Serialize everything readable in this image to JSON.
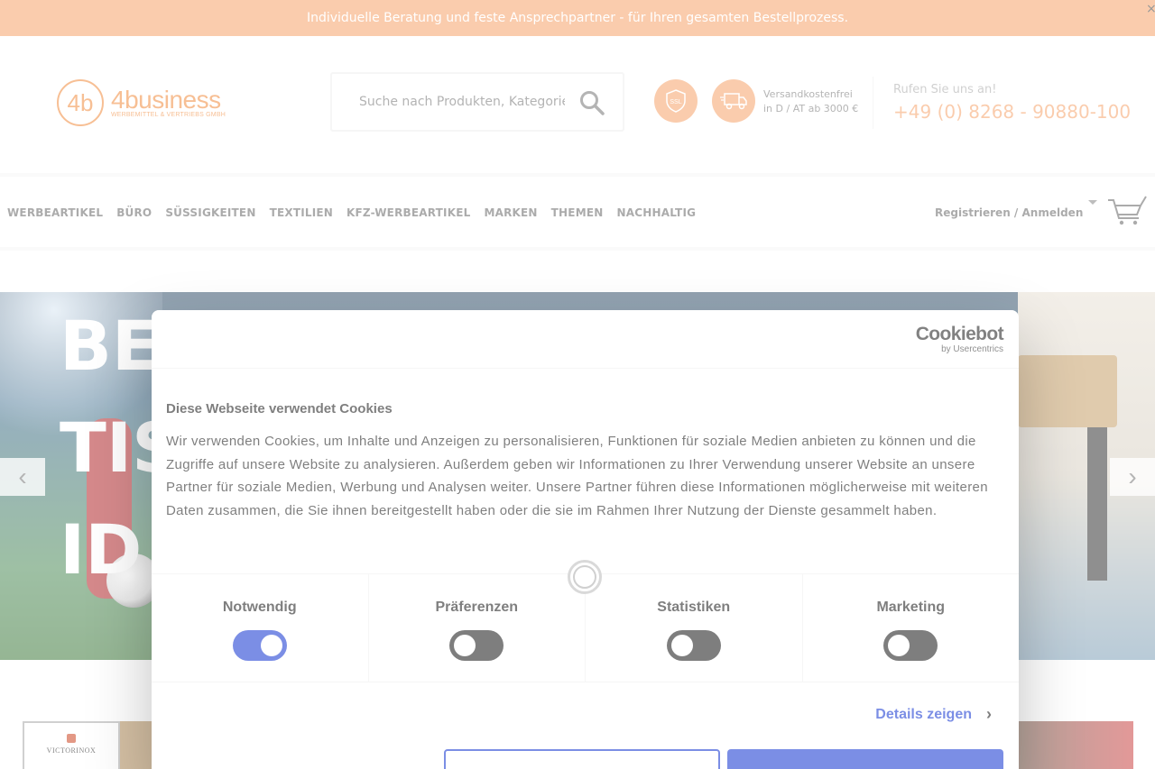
{
  "topbar": {
    "message": "Individuelle Beratung und feste Ansprechpartner - für Ihren gesamten Bestellprozess.",
    "close": "×"
  },
  "header": {
    "logo_mark": "4b",
    "logo_name": "4business",
    "logo_sub": "WERBEMITTEL & VERTRIEBS GMBH",
    "search_placeholder": "Suche nach Produkten, Kategorien",
    "ssl_label": "SSL",
    "shipping_line1": "Versandkostenfrei",
    "shipping_line2": "in D / AT ab 3000 €",
    "call_label": "Rufen Sie uns an!",
    "call_phone": "+49 (0) 8268 - 90880-100"
  },
  "nav": {
    "items": [
      "WERBEARTIKEL",
      "BÜRO",
      "SÜSSIGKEITEN",
      "TEXTILIEN",
      "KFZ-WERBEARTIKEL",
      "MARKEN",
      "THEMEN",
      "NACHHALTIG"
    ],
    "register": "Registrieren",
    "separator": "/",
    "login": "Anmelden"
  },
  "hero": {
    "line1": "BE",
    "line2": "TIS",
    "line3": "ID",
    "prev": "‹",
    "next": "›"
  },
  "strip": {
    "brand": "VICTORINOX"
  },
  "cookie": {
    "brand_name": "Cookiebot",
    "brand_sub": "by Usercentrics",
    "title": "Diese Webseite verwendet Cookies",
    "text": "Wir verwenden Cookies, um Inhalte und Anzeigen zu personalisieren, Funktionen für soziale Medien anbieten zu können und die Zugriffe auf unsere Website zu analysieren. Außerdem geben wir Informationen zu Ihrer Verwendung unserer Website an unsere Partner für soziale Medien, Werbung und Analysen weiter. Unsere Partner führen diese Informationen möglicherweise mit weiteren Daten zusammen, die Sie ihnen bereitgestellt haben oder die sie im Rahmen Ihrer Nutzung der Dienste gesammelt haben.",
    "categories": [
      {
        "label": "Notwendig",
        "on": true
      },
      {
        "label": "Präferenzen",
        "on": false
      },
      {
        "label": "Statistiken",
        "on": false
      },
      {
        "label": "Marketing",
        "on": false
      }
    ],
    "details": "Details zeigen",
    "details_chevron": "›"
  },
  "colors": {
    "accent": "#f6a36a",
    "cookie_blue": "#1032cf"
  }
}
